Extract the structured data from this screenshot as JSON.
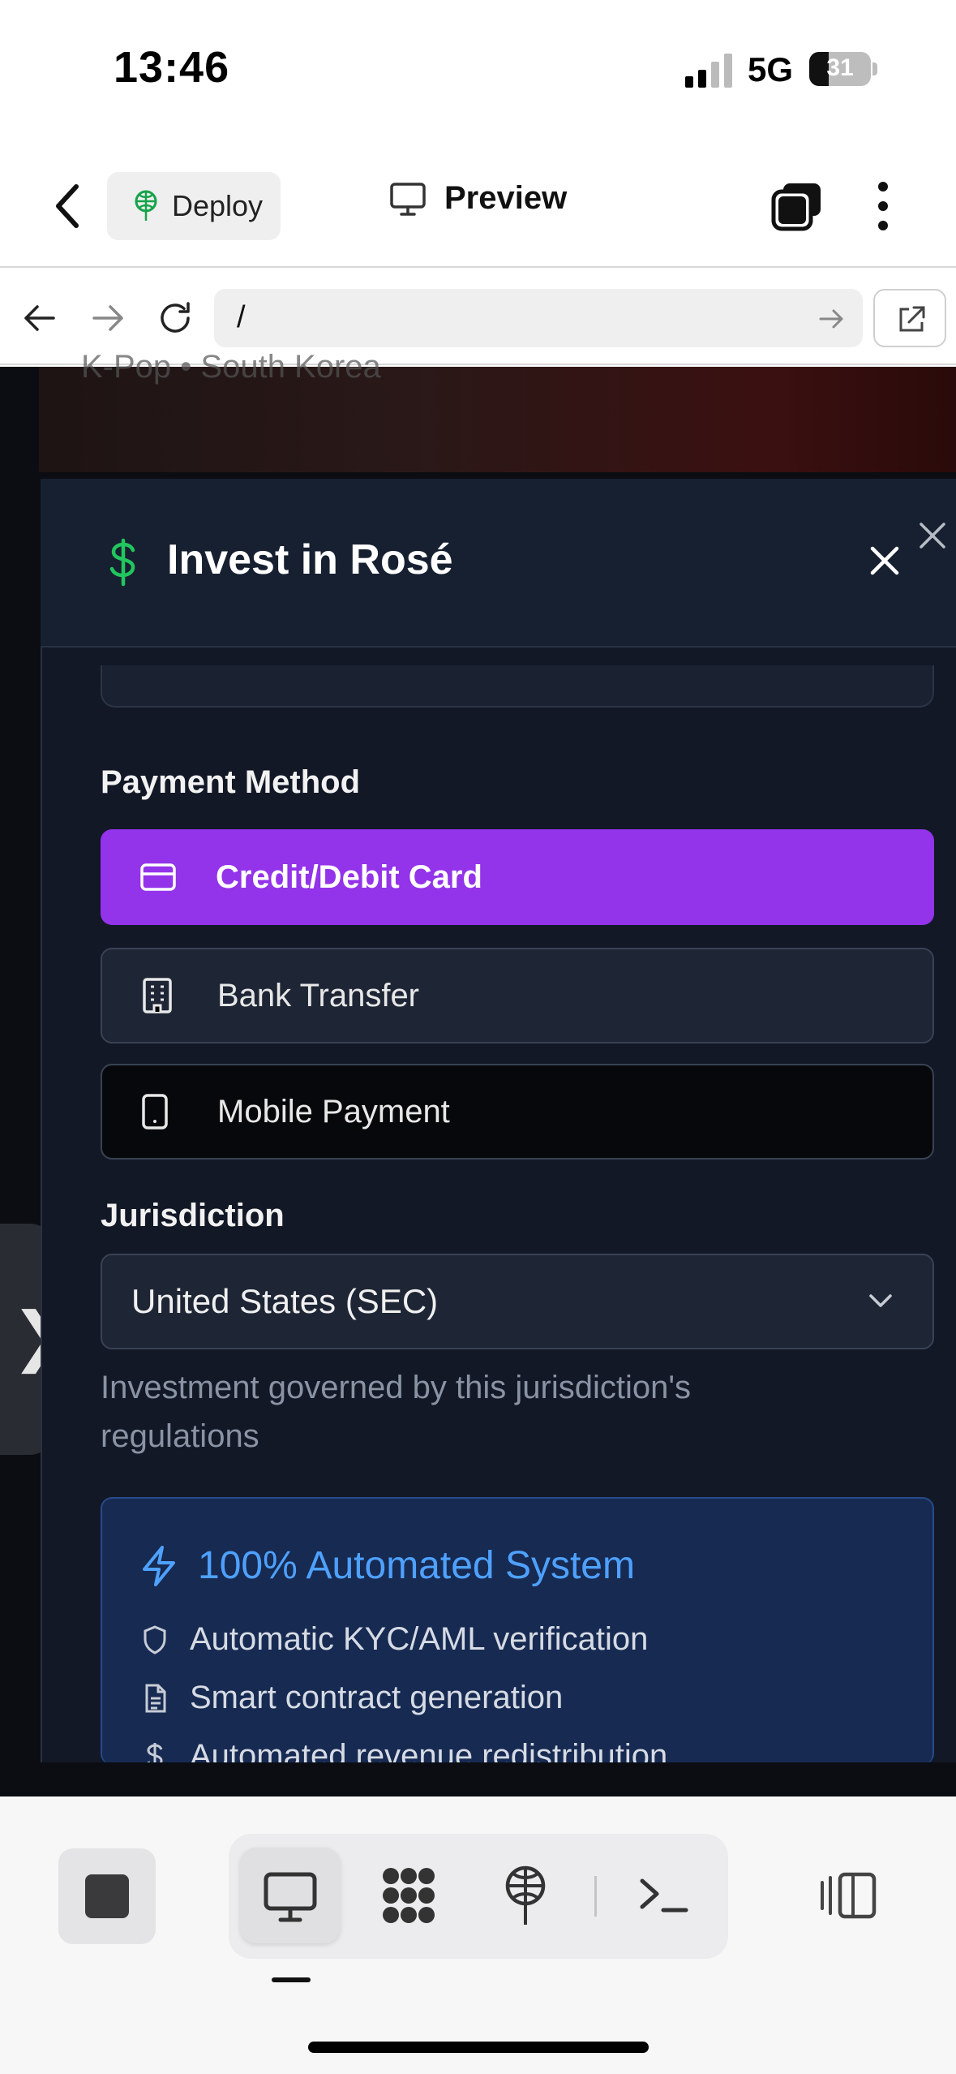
{
  "status_bar": {
    "time": "13:46",
    "network": "5G",
    "battery_level": "31",
    "battery_fraction": 0.31
  },
  "app_header": {
    "deploy_label": "Deploy",
    "preview_label": "Preview"
  },
  "url_bar": {
    "url": "/"
  },
  "background_page": {
    "hero_subtitle": "K-Pop • South Korea",
    "side_tab_glyph": "❯"
  },
  "modal": {
    "title": "Invest in Rosé",
    "title_icon": "dollar-icon",
    "payment_method": {
      "label": "Payment Method",
      "options": [
        {
          "label": "Credit/Debit Card",
          "icon": "credit-card-icon",
          "selected": true
        },
        {
          "label": "Bank Transfer",
          "icon": "building-icon",
          "selected": false
        },
        {
          "label": "Mobile Payment",
          "icon": "smartphone-icon",
          "selected": false
        }
      ]
    },
    "jurisdiction": {
      "label": "Jurisdiction",
      "selected": "United States (SEC)",
      "help": "Investment governed by this jurisdiction's regulations"
    },
    "automation": {
      "title": "100% Automated System",
      "features": [
        {
          "text": "Automatic KYC/AML verification",
          "icon": "shield-icon"
        },
        {
          "text": "Smart contract generation",
          "icon": "document-icon"
        },
        {
          "text": "Automated revenue redistribution",
          "icon": "dollar-icon"
        }
      ]
    }
  },
  "colors": {
    "accent_purple": "#9333ea",
    "accent_green": "#22c55e",
    "accent_blue": "#4ea1ff",
    "modal_bg": "#121826"
  },
  "toolbar": {
    "items": [
      "stop-icon",
      "desktop-icon",
      "apps-icon",
      "deploy-icon",
      "terminal-icon",
      "panel-toggle-icon"
    ]
  }
}
